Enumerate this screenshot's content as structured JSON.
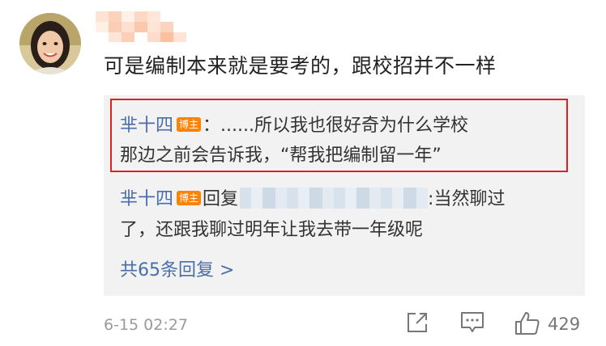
{
  "comment": {
    "text": "可是编制本来就是要考的，跟校招并不一样",
    "timestamp": "6-15 02:27",
    "like_count": "429",
    "avatar_icon": "user-avatar-photo"
  },
  "replies": [
    {
      "author": "芈十四",
      "badge": "博主",
      "line1": "：......所以我也很好奇为什么学校",
      "line2": "那边之前会告诉我，“帮我把编制留一年”"
    },
    {
      "author": "芈十四",
      "badge": "博主",
      "reply_word": "回复",
      "after_blur": ":当然聊过",
      "line2": "了，还跟我聊过明年让我去带一年级呢"
    }
  ],
  "more_replies": "共65条回复 >",
  "actions": {
    "share_icon": "share-icon",
    "comment_icon": "comment-icon",
    "like_icon": "thumbs-up-icon"
  },
  "colors": {
    "link": "#4a6ea8",
    "badge": "#ff8200",
    "highlight_border": "#e02020",
    "reply_bg": "#f2f2f2"
  }
}
